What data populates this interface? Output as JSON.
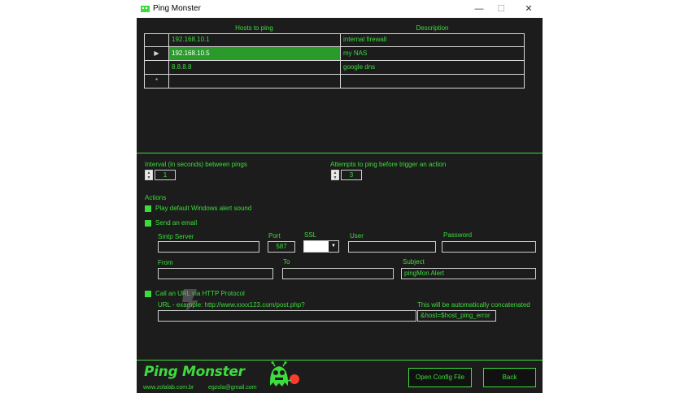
{
  "window": {
    "title": "Ping Monster",
    "controls": {
      "minimize": "—",
      "maximize": "☐",
      "close": "✕"
    }
  },
  "grid": {
    "columns": [
      "Hosts to ping",
      "Description"
    ],
    "rows": [
      {
        "selector": "",
        "host": "192.168.10.1",
        "description": "internal firewall"
      },
      {
        "selector": "▶",
        "host": "192.168.10.5",
        "description": "my NAS"
      },
      {
        "selector": "",
        "host": "8.8.8.8",
        "description": "google dns"
      },
      {
        "selector": "*",
        "host": "",
        "description": ""
      }
    ]
  },
  "interval": {
    "label": "Interval (in seconds) between pings",
    "value": "1"
  },
  "attempts": {
    "label": "Attempts to ping before trigger an action",
    "value": "3"
  },
  "actions": {
    "label": "Actions",
    "play_sound": "Play default Windows alert sound",
    "send_email": "Send an email",
    "call_url": "Call an URL via HTTP Protocol"
  },
  "email": {
    "smtp_label": "Smtp Server",
    "smtp_value": "",
    "port_label": "Port",
    "port_value": "587",
    "ssl_label": "SSL",
    "user_label": "User",
    "user_value": "",
    "password_label": "Password",
    "password_value": "",
    "from_label": "From",
    "from_value": "",
    "to_label": "To",
    "to_value": "",
    "subject_label": "Subject",
    "subject_value": "pingMon Alert"
  },
  "url": {
    "label": "URL   -   example:  http://www.xxxx123.com/post.php?",
    "value": "",
    "concat_label": "This will be automatically concatenated",
    "concat_value": "&host=$host_ping_error"
  },
  "footer": {
    "logo": "Ping Monster",
    "website": "www.zolalab.com.br",
    "email": "egzola@gmail.com",
    "open_config": "Open Config File",
    "back": "Back"
  },
  "colors": {
    "accent": "#3ddc3d",
    "background": "#1c1c1c",
    "selected_row": "#2a9a2a"
  }
}
